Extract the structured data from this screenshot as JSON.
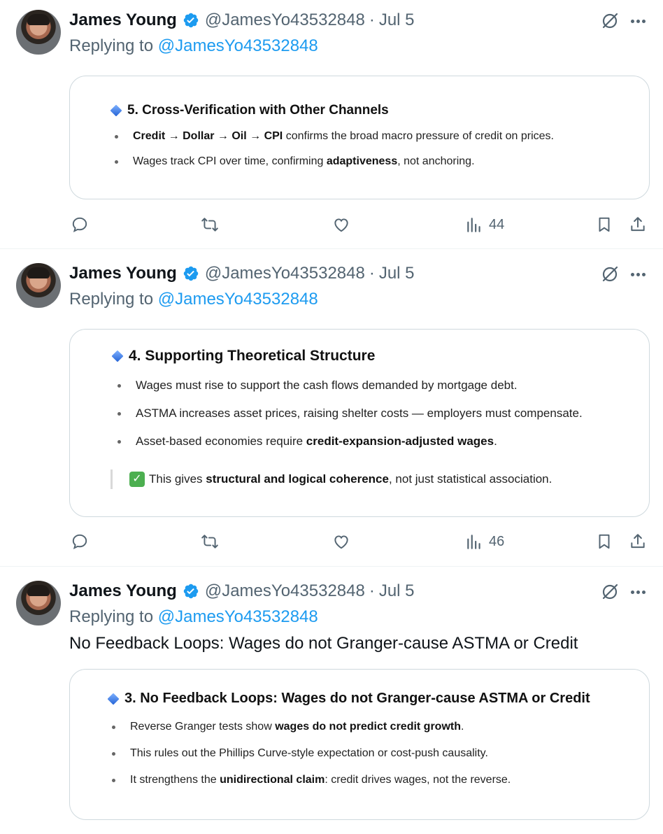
{
  "tweets": [
    {
      "author": "James Young",
      "handle": "@JamesYo43532848",
      "dot": "·",
      "date": "Jul 5",
      "replying_prefix": "Replying to ",
      "replying_to": "@JamesYo43532848",
      "card": {
        "heading": "5. Cross-Verification with Other Channels",
        "bullets": [
          {
            "bold": "Credit → Dollar → Oil → CPI",
            "rest": " confirms the broad macro pressure of credit on prices."
          },
          {
            "pre": "Wages track CPI over time, confirming ",
            "bold": "adaptiveness",
            "rest": ", not anchoring."
          }
        ]
      },
      "views": "44"
    },
    {
      "author": "James Young",
      "handle": "@JamesYo43532848",
      "dot": "·",
      "date": "Jul 5",
      "replying_prefix": "Replying to ",
      "replying_to": "@JamesYo43532848",
      "card": {
        "heading": "4. Supporting Theoretical Structure",
        "bullets": [
          {
            "pre": "Wages must rise to support the cash flows demanded by mortgage debt."
          },
          {
            "pre": "ASTMA increases asset prices, raising shelter costs — employers must compensate."
          },
          {
            "pre": "Asset-based economies require ",
            "bold": "credit-expansion-adjusted wages",
            "rest": "."
          }
        ],
        "quote_check": "✓",
        "quote_pre": "This gives ",
        "quote_bold": "structural and logical coherence",
        "quote_rest": ", not just statistical association."
      },
      "views": "46"
    },
    {
      "author": "James Young",
      "handle": "@JamesYo43532848",
      "dot": "·",
      "date": "Jul 5",
      "replying_prefix": "Replying to ",
      "replying_to": "@JamesYo43532848",
      "text": "No Feedback Loops: Wages do not Granger-cause ASTMA or Credit",
      "card": {
        "heading": "3. No Feedback Loops: Wages do not Granger-cause ASTMA or Credit",
        "bullets": [
          {
            "pre": "Reverse Granger tests show ",
            "bold": "wages do not predict credit growth",
            "rest": "."
          },
          {
            "pre": "This rules out the Phillips Curve-style expectation or cost-push causality."
          },
          {
            "pre": "It strengthens the ",
            "bold": "unidirectional claim",
            "rest": ": credit drives wages, not the reverse."
          }
        ]
      }
    }
  ],
  "colors": {
    "accent": "#1d9bf0",
    "muted": "#536471",
    "border": "#cfd9de"
  },
  "icons": [
    "verified-badge-icon",
    "grok-icon",
    "more-icon",
    "reply-icon",
    "retweet-icon",
    "like-icon",
    "views-icon",
    "bookmark-icon",
    "share-icon"
  ]
}
